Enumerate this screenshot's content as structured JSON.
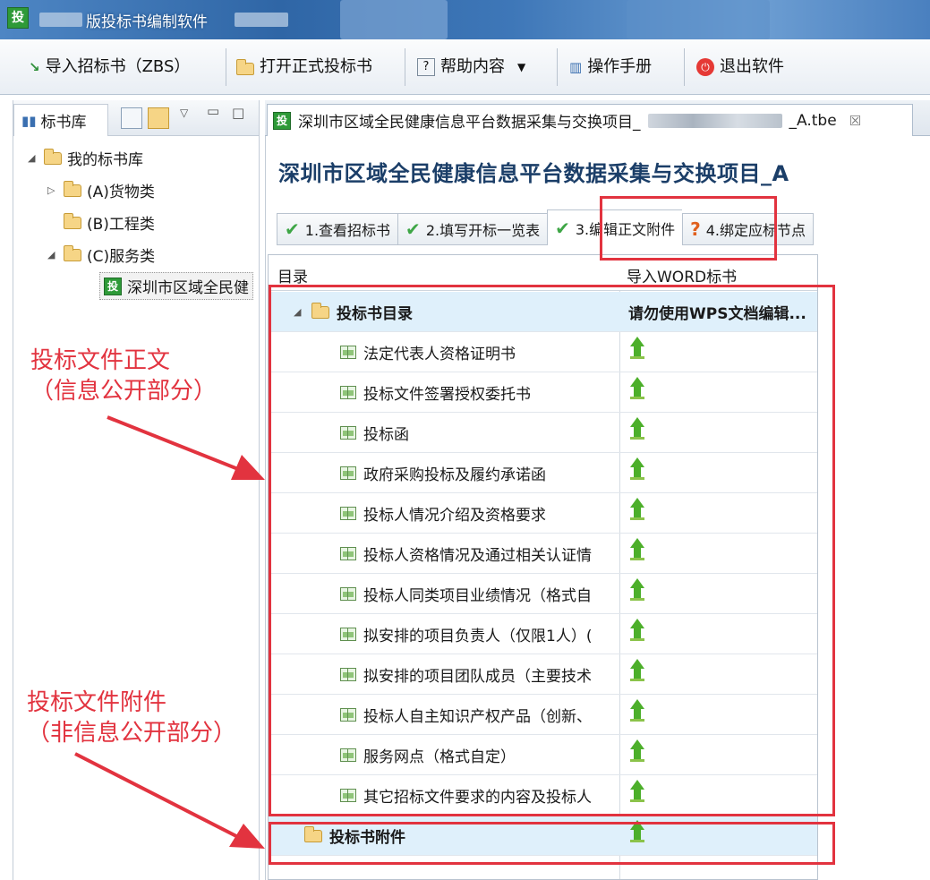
{
  "window": {
    "app_icon_glyph": "投",
    "title": "版投标书编制软件"
  },
  "toolbar": {
    "import_label": "导入招标书（ZBS）",
    "open_label": "打开正式投标书",
    "help_label": "帮助内容",
    "manual_label": "操作手册",
    "exit_label": "退出软件"
  },
  "left_panel": {
    "tab_label": "标书库",
    "tree": {
      "root": "我的标书库",
      "cat_a": "(A)货物类",
      "cat_b": "(B)工程类",
      "cat_c": "(C)服务类",
      "leaf": "深圳市区域全民健"
    }
  },
  "editor": {
    "tab_icon_glyph": "投",
    "tab_title_prefix": "深圳市区域全民健康信息平台数据采集与交换项目_",
    "tab_title_suffix": "_A.tbe",
    "tab_close": "☒",
    "project_title": "深圳市区域全民健康信息平台数据采集与交换项目_A",
    "steps": [
      "1.查看招标书",
      "2.填写开标一览表",
      "3.编辑正文附件",
      "4.绑定应标节点"
    ],
    "grid": {
      "col_directory": "目录",
      "col_import": "导入WORD标书",
      "group_main": "投标书目录",
      "group_main_note": "请勿使用WPS文档编辑...",
      "items": [
        "法定代表人资格证明书",
        "投标文件签署授权委托书",
        "投标函",
        "政府采购投标及履约承诺函",
        "投标人情况介绍及资格要求",
        "投标人资格情况及通过相关认证情",
        "投标人同类项目业绩情况（格式自",
        "拟安排的项目负责人（仅限1人）(",
        "拟安排的项目团队成员（主要技术",
        "投标人自主知识产权产品（创新、",
        "服务网点（格式自定）",
        "其它招标文件要求的内容及投标人"
      ],
      "group_attach": "投标书附件"
    }
  },
  "annotations": {
    "main_line1": "投标文件正文",
    "main_line2": "（信息公开部分）",
    "attach_line1": "投标文件附件",
    "attach_line2": "（非信息公开部分）",
    "color": "#e2333f"
  }
}
